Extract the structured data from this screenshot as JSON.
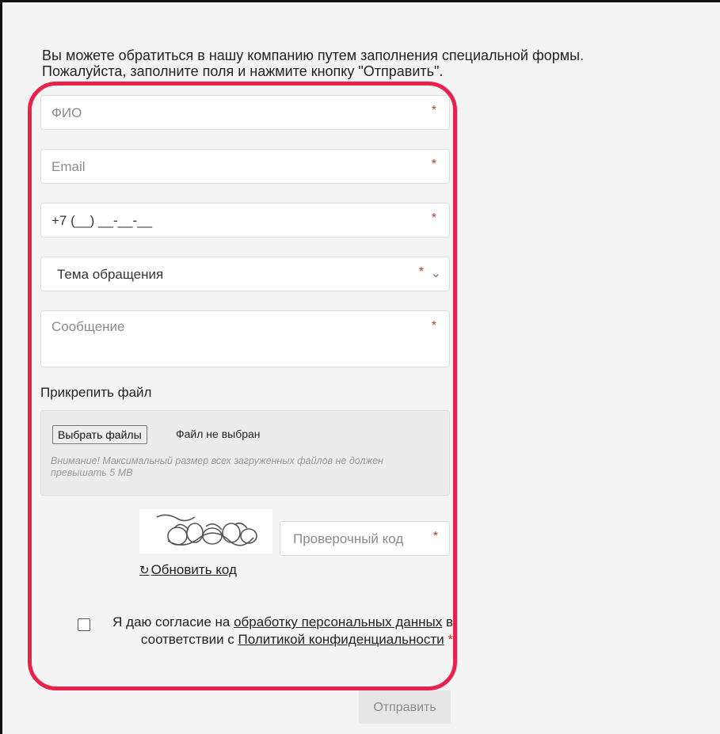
{
  "intro": {
    "line1": "Вы можете обратиться в нашу компанию путем заполнения специальной формы.",
    "line2": "Пожалуйста, заполните поля и нажмите кнопку \"Отправить\"."
  },
  "form": {
    "name_placeholder": "ФИО",
    "email_placeholder": "Email",
    "phone_mask": "+7 (__) __-__-__",
    "topic_placeholder": "Тема обращения",
    "message_placeholder": "Сообщение",
    "required_mark": "*",
    "attach_label": "Прикрепить файл",
    "file_button": "Выбрать файлы",
    "file_status": "Файл не выбран",
    "file_note": "Внимание! Максимальный размер всех загруженных файлов не должен превышать 5 MB",
    "captcha_placeholder": "Проверочный код",
    "refresh_link": "Обновить код",
    "refresh_icon": "refresh-icon",
    "consent_prefix": "Я даю согласие на ",
    "consent_link1": "обработку персональных данных",
    "consent_middle": " в соответствии с ",
    "consent_link2": "Политикой конфиденциальности",
    "submit_label": "Отправить"
  },
  "colors": {
    "highlight": "#e8224a",
    "required": "#c0392b",
    "background": "#f4f4f4"
  }
}
